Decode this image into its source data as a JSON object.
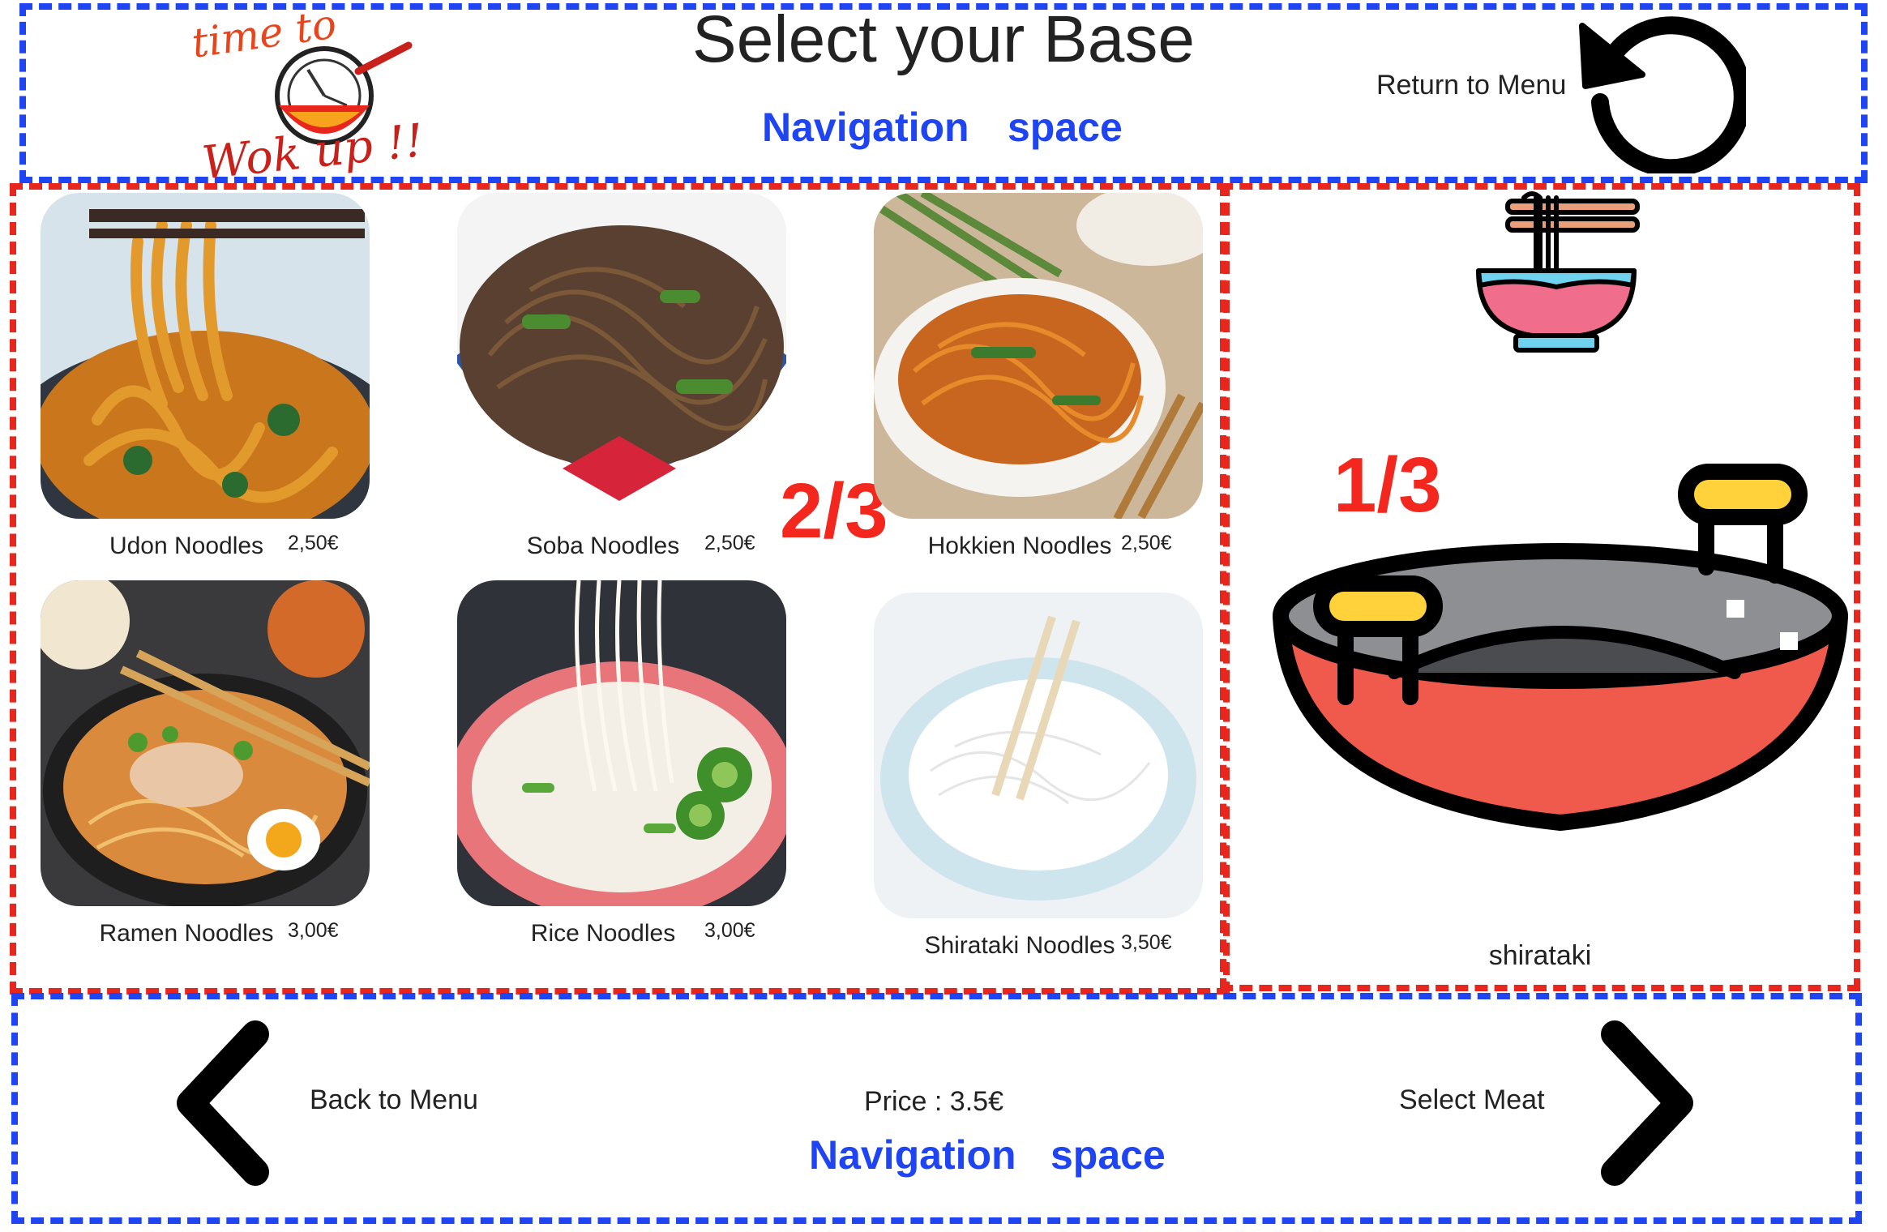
{
  "header": {
    "title": "Select your Base",
    "nav_label_1": "Navigation",
    "nav_label_2": "space",
    "logo_text_top": "time to",
    "logo_text_bottom": "Wok up !!",
    "return_label": "Return to Menu",
    "return_icon": "undo-arrow-icon"
  },
  "grid": {
    "step_label": "2/3",
    "items": [
      {
        "name": "Udon Noodles",
        "price": "2,50€"
      },
      {
        "name": "Soba Noodles",
        "price": "2,50€"
      },
      {
        "name": "Hokkien Noodles",
        "price": "2,50€"
      },
      {
        "name": "Ramen Noodles",
        "price": "3,00€"
      },
      {
        "name": "Rice Noodles",
        "price": "3,00€"
      },
      {
        "name": "Shirataki Noodles",
        "price": "3,50€"
      }
    ]
  },
  "preview": {
    "step_label": "1/3",
    "selected_name": "shirataki",
    "icons": [
      "noodle-bowl-icon",
      "wok-icon"
    ]
  },
  "footer": {
    "back_label": "Back to Menu",
    "price_label": "Price : 3.5€",
    "next_label": "Select Meat",
    "nav_label_1": "Navigation",
    "nav_label_2": "space"
  },
  "colors": {
    "nav_blue": "#1f45f2",
    "step_red": "#f3271d",
    "wok_red": "#ef5a4c"
  }
}
